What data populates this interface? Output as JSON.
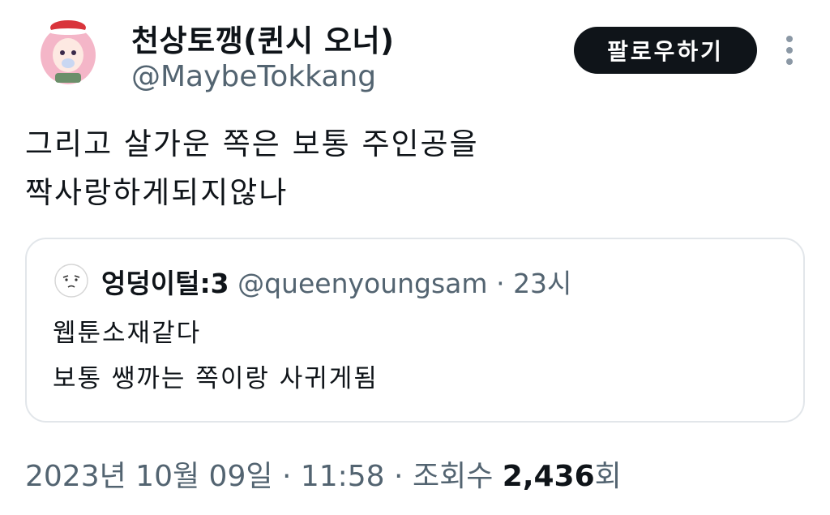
{
  "author": {
    "display_name": "천상토깽(퀸시 오너)",
    "handle": "@MaybeTokkang",
    "avatar_icon": "anime-character-avatar"
  },
  "follow_button": {
    "label": "팔로우하기"
  },
  "more_button": {
    "icon": "more-vertical-icon"
  },
  "tweet": {
    "lines": [
      "그리고 살가운 쪽은 보통 주인공을",
      "짝사랑하게되지않나"
    ]
  },
  "quote": {
    "display_name": "엉덩이털:3",
    "handle": "@queenyoungsam",
    "separator": "·",
    "time": "23시",
    "lines": [
      "웹툰소재같다",
      "보통 쌩까는 쪽이랑 사귀게됨"
    ],
    "avatar_icon": "doodle-face-avatar"
  },
  "meta": {
    "date": "2023년 10월 09일",
    "separator": "·",
    "time": "11:58",
    "views_label": "조회수",
    "views_count": "2,436",
    "views_suffix": "회"
  },
  "colors": {
    "text_primary": "#0f1419",
    "text_secondary": "#536471",
    "button_bg": "#0f1419",
    "border": "#e2e6ea"
  }
}
